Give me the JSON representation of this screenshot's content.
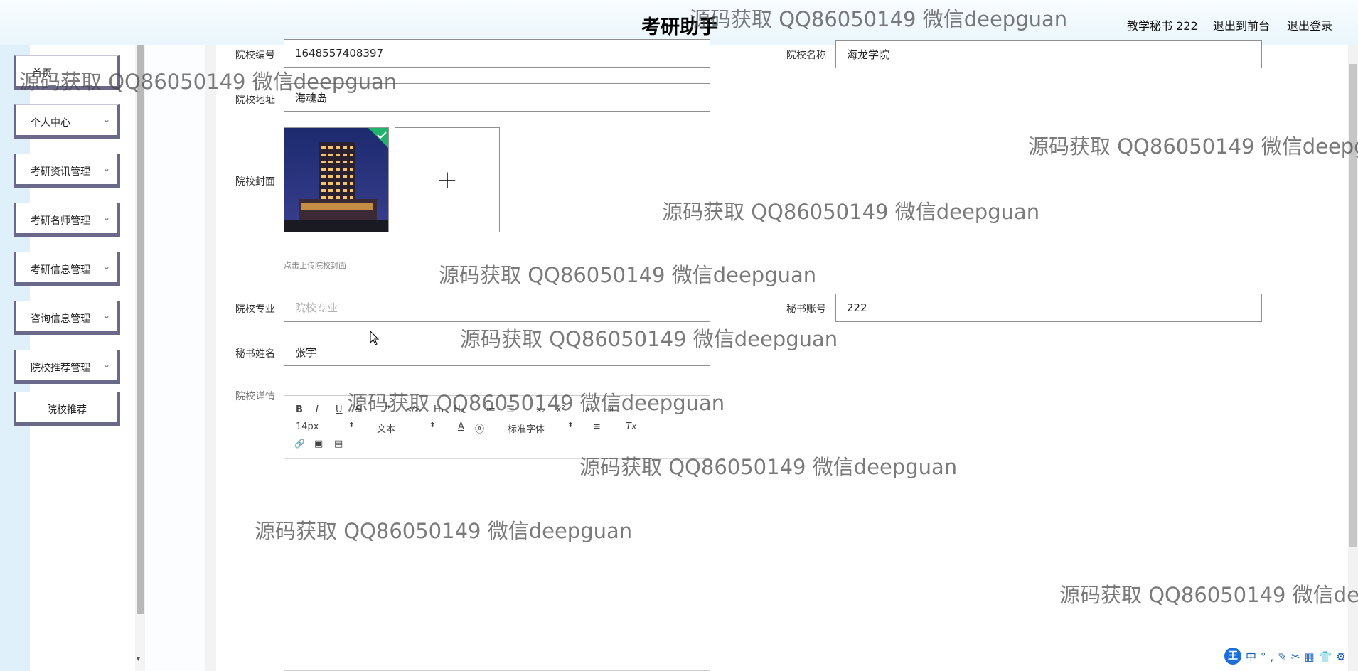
{
  "header": {
    "title": "考研助手",
    "user": "教学秘书 222",
    "to_front": "退出到前台",
    "logout": "退出登录"
  },
  "sidebar": {
    "items": [
      {
        "label": "首页",
        "has_chevron": false
      },
      {
        "label": "个人中心",
        "has_chevron": true
      },
      {
        "label": "考研资讯管理",
        "has_chevron": true
      },
      {
        "label": "考研名师管理",
        "has_chevron": true
      },
      {
        "label": "考研信息管理",
        "has_chevron": true
      },
      {
        "label": "咨询信息管理",
        "has_chevron": true
      },
      {
        "label": "院校推荐管理",
        "has_chevron": true
      },
      {
        "label": "院校推荐",
        "has_chevron": false
      }
    ],
    "chevron_glyph": "⌄"
  },
  "form": {
    "school_no": {
      "label": "院校编号",
      "value": "1648557408397"
    },
    "school_name": {
      "label": "院校名称",
      "value": "海龙学院"
    },
    "school_address": {
      "label": "院校地址",
      "value": "海魂岛"
    },
    "cover": {
      "label": "院校封面",
      "upload_symbol": "+",
      "tip": "点击上传院校封面"
    },
    "major": {
      "label": "院校专业",
      "value": "",
      "placeholder": "院校专业"
    },
    "secretary_account": {
      "label": "秘书账号",
      "value": "222"
    },
    "secretary_name": {
      "label": "秘书姓名",
      "value": "张宇"
    },
    "details": {
      "label": "院校详情"
    }
  },
  "editor": {
    "row1": [
      "B",
      "I",
      "U",
      "S",
      "❞",
      "</>",
      "H₁",
      "H₂",
      "≔",
      "☰",
      "x₂",
      "x²",
      "⇤",
      "⇥"
    ],
    "font_size": "14px",
    "text_style": "文本",
    "font_family": "标准字体",
    "row2_icons": [
      "A",
      "Ⓐ",
      "≡",
      "Tx"
    ],
    "row3_icons": [
      "🔗",
      "▣",
      "▤"
    ]
  },
  "watermark_text": "源码获取 QQ86050149 微信deepguan",
  "ime": {
    "badge": "王",
    "glyphs": "中°,✎✂▦👕⚙"
  },
  "colors": {
    "sidebar_border": "#6b6989",
    "background": "#e9f5fb"
  }
}
